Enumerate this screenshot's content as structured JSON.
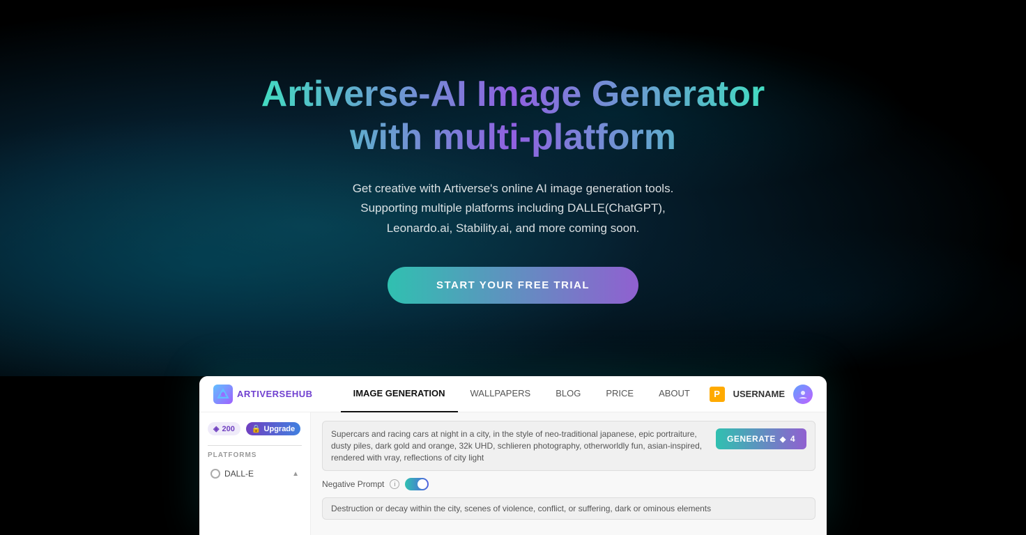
{
  "hero": {
    "title": "Artiverse-AI Image Generator with multi-platform",
    "subtitle_line1": "Get creative with Artiverse's online AI image generation tools.",
    "subtitle_line2": "Supporting multiple platforms including DALLE(ChatGPT),",
    "subtitle_line3": "Leonardo.ai, Stability.ai, and more coming soon.",
    "cta_label": "START YOUR FREE TRIAL"
  },
  "app": {
    "logo_text_prefix": "ARTIVERSE",
    "logo_text_suffix": "HUB",
    "nav_items": [
      {
        "label": "IMAGE GENERATION",
        "active": true
      },
      {
        "label": "WALLPAPERS",
        "active": false
      },
      {
        "label": "BLOG",
        "active": false
      },
      {
        "label": "PRICE",
        "active": false
      },
      {
        "label": "ABOUT",
        "active": false
      }
    ],
    "nav_username": "USERNAME",
    "sidebar": {
      "credits": "200",
      "upgrade_label": "Upgrade",
      "section_label": "PLATFORMS",
      "platform_item": "DALL-E"
    },
    "prompt": {
      "text": "Supercars and racing cars at night in a city, in the style of neo-traditional japanese, epic portraiture, dusty piles, dark gold and orange, 32k UHD, schlieren photography, otherworldly fun, asian-inspired, rendered with vray, reflections of city light",
      "generate_label": "GENERATE",
      "diamond_count": "4"
    },
    "negative_prompt": {
      "label": "Negative Prompt",
      "input_text": "Destruction or decay within the city, scenes of violence, conflict, or suffering, dark or ominous elements"
    }
  }
}
